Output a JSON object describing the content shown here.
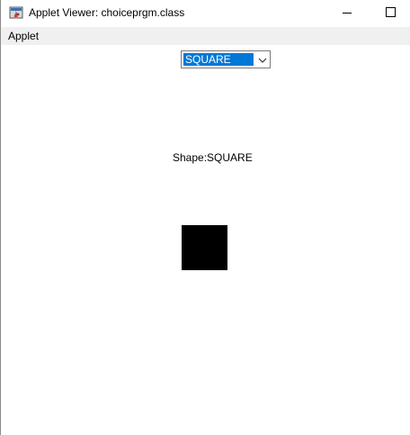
{
  "window": {
    "title": "Applet Viewer: choiceprgm.class"
  },
  "menubar": {
    "items": [
      {
        "label": "Applet"
      }
    ]
  },
  "applet": {
    "choice": {
      "selected": "SQUARE"
    },
    "shape_label": "Shape:SQUARE"
  },
  "colors": {
    "selection": "#0078d7",
    "shape_fill": "#000000",
    "menubar_bg": "#f0f0f0"
  },
  "icons": {
    "app": "java-applet-icon",
    "dropdown": "chevron-down-icon"
  }
}
